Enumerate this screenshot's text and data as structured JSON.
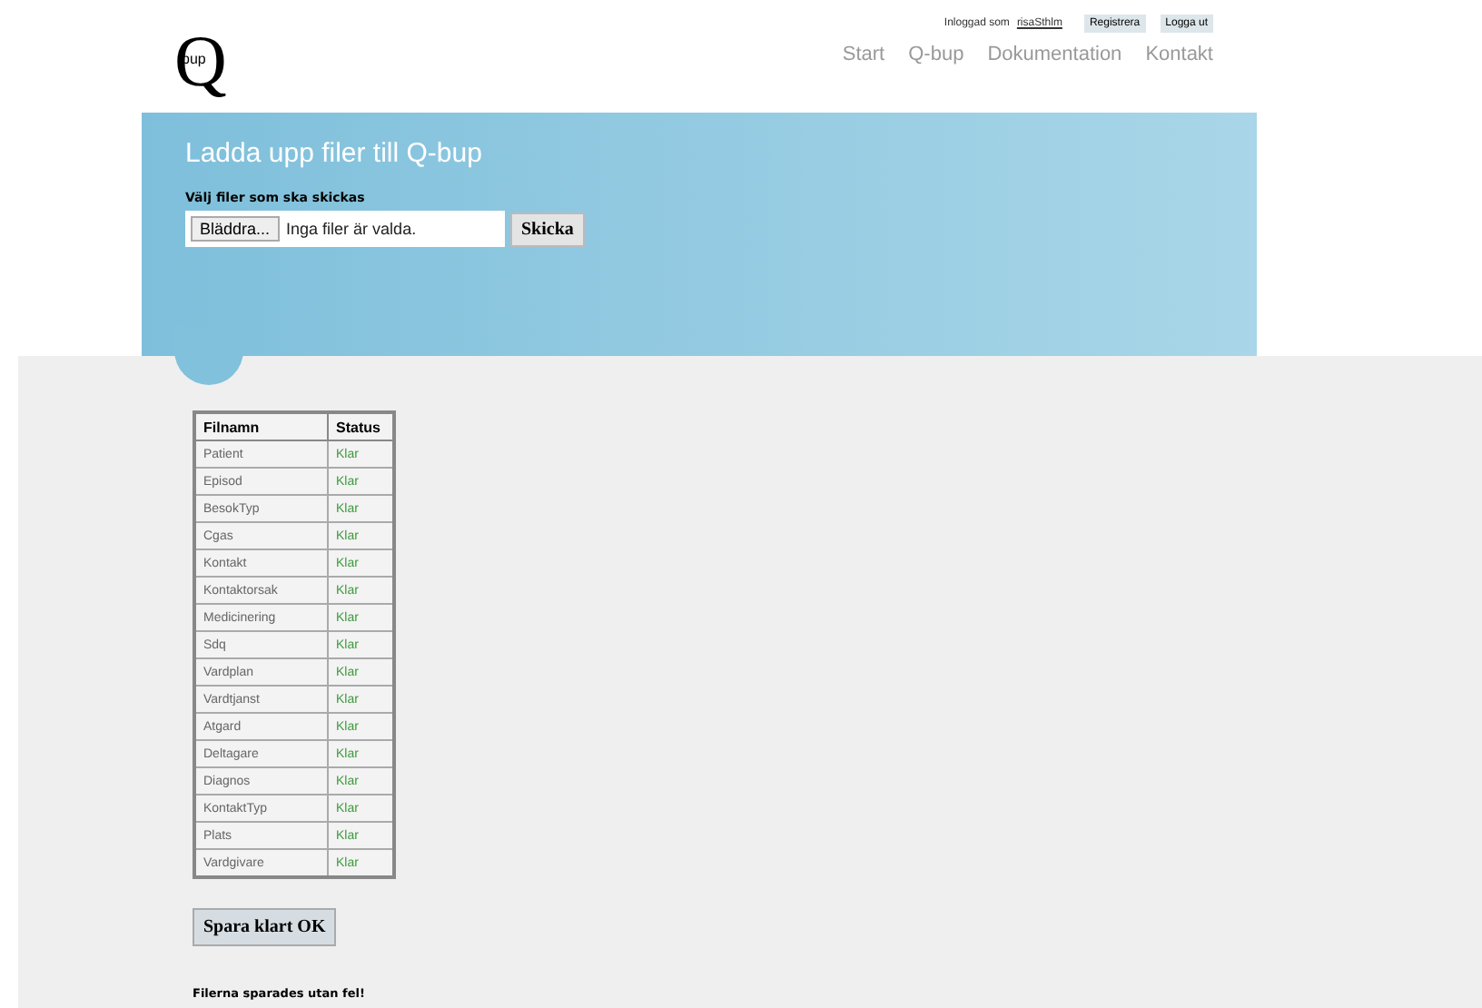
{
  "logo": {
    "letter": "Q",
    "inner": "bup"
  },
  "user_bar": {
    "label": "Inloggad som",
    "user": "risaSthlm",
    "buttons": [
      "Registrera",
      "Logga ut"
    ]
  },
  "nav": [
    "Start",
    "Q-bup",
    "Dokumentation",
    "Kontakt"
  ],
  "upload": {
    "title": "Ladda upp filer till Q-bup",
    "label": "Välj filer som ska skickas",
    "browse": "Bläddra...",
    "file_status": "Inga filer är valda.",
    "submit": "Skicka"
  },
  "table": {
    "columns": [
      "Filnamn",
      "Status"
    ],
    "rows": [
      {
        "name": "Patient",
        "status": "Klar"
      },
      {
        "name": "Episod",
        "status": "Klar"
      },
      {
        "name": "BesokTyp",
        "status": "Klar"
      },
      {
        "name": "Cgas",
        "status": "Klar"
      },
      {
        "name": "Kontakt",
        "status": "Klar"
      },
      {
        "name": "Kontaktorsak",
        "status": "Klar"
      },
      {
        "name": "Medicinering",
        "status": "Klar"
      },
      {
        "name": "Sdq",
        "status": "Klar"
      },
      {
        "name": "Vardplan",
        "status": "Klar"
      },
      {
        "name": "Vardtjanst",
        "status": "Klar"
      },
      {
        "name": "Atgard",
        "status": "Klar"
      },
      {
        "name": "Deltagare",
        "status": "Klar"
      },
      {
        "name": "Diagnos",
        "status": "Klar"
      },
      {
        "name": "KontaktTyp",
        "status": "Klar"
      },
      {
        "name": "Plats",
        "status": "Klar"
      },
      {
        "name": "Vardgivare",
        "status": "Klar"
      }
    ]
  },
  "save_button": "Spara klart OK",
  "message": "Filerna sparades utan fel!"
}
